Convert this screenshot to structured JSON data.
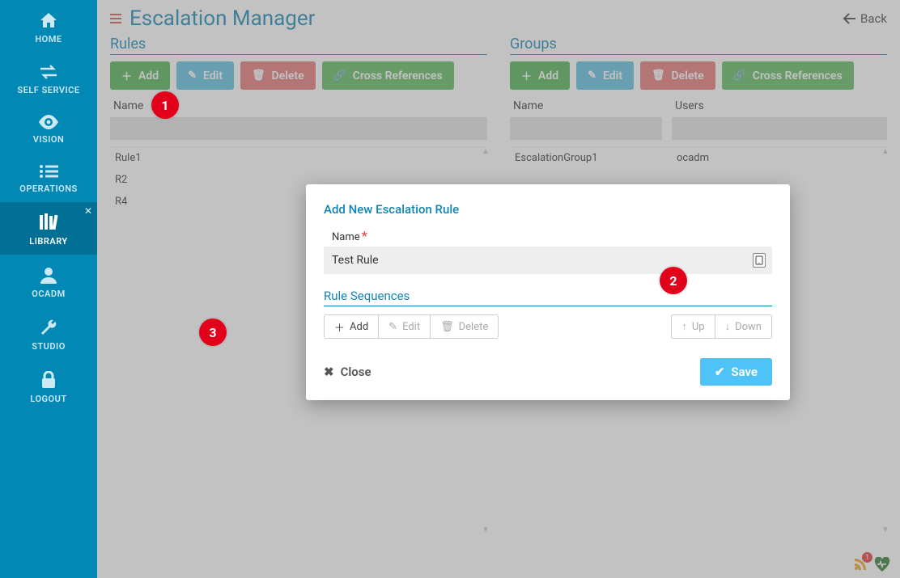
{
  "sidebar": {
    "items": [
      {
        "label": "HOME"
      },
      {
        "label": "SELF SERVICE"
      },
      {
        "label": "VISION"
      },
      {
        "label": "OPERATIONS"
      },
      {
        "label": "LIBRARY"
      },
      {
        "label": "OCADM"
      },
      {
        "label": "STUDIO"
      },
      {
        "label": "LOGOUT"
      }
    ]
  },
  "header": {
    "title": "Escalation Manager",
    "back": "Back"
  },
  "toolbar": {
    "add": "Add",
    "edit": "Edit",
    "delete": "Delete",
    "cross": "Cross References"
  },
  "rules": {
    "title": "Rules",
    "columns": {
      "name": "Name"
    },
    "rows": [
      {
        "name": "Rule1"
      },
      {
        "name": "R2"
      },
      {
        "name": "R4"
      }
    ]
  },
  "groups": {
    "title": "Groups",
    "columns": {
      "name": "Name",
      "users": "Users"
    },
    "rows": [
      {
        "name": "EscalationGroup1",
        "users": "ocadm"
      }
    ]
  },
  "modal": {
    "title": "Add New Escalation Rule",
    "name_label": "Name",
    "name_value": "Test Rule",
    "subsection": "Rule Sequences",
    "seq_buttons": {
      "add": "Add",
      "edit": "Edit",
      "delete": "Delete",
      "up": "Up",
      "down": "Down"
    },
    "close": "Close",
    "save": "Save"
  },
  "callouts": {
    "c1": "1",
    "c2": "2",
    "c3": "3"
  },
  "status": {
    "rss_count": "1"
  }
}
